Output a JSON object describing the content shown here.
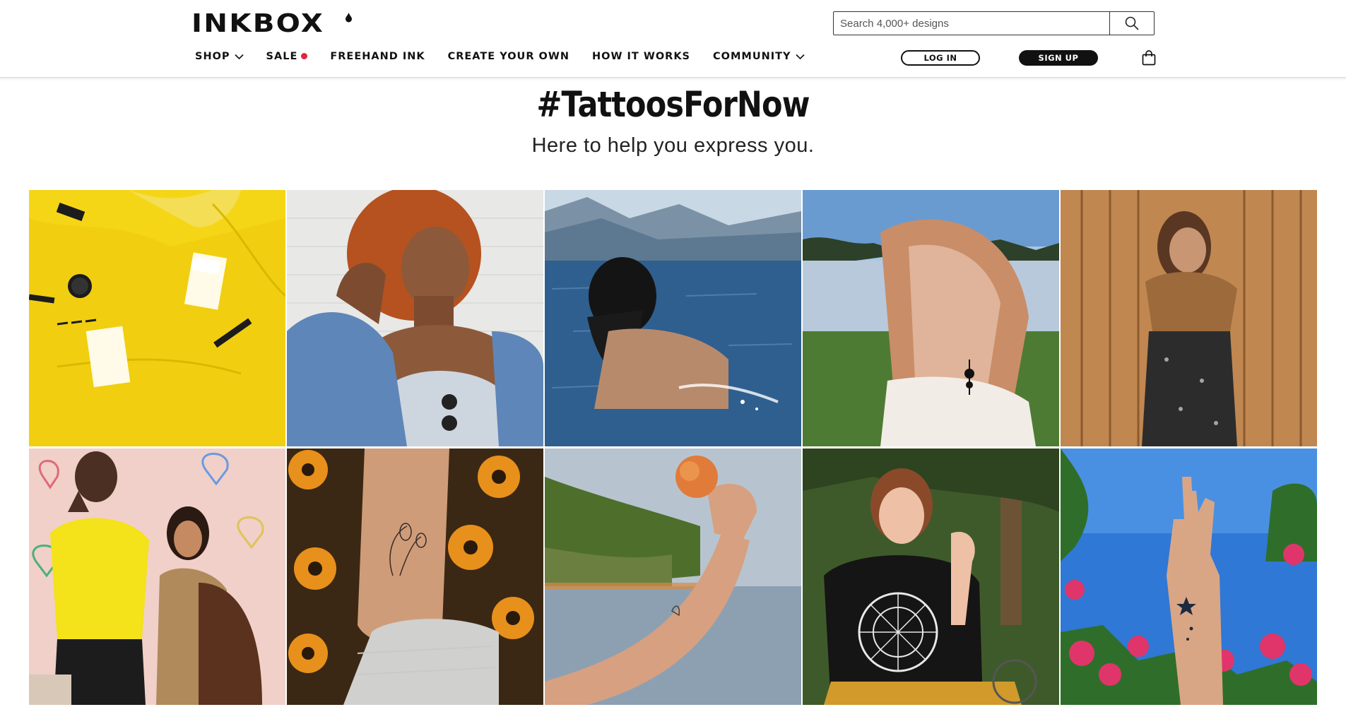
{
  "brand": {
    "logo_text": "INKBOX"
  },
  "search": {
    "placeholder": "Search 4,000+ designs",
    "icon": "search-icon"
  },
  "nav": {
    "items": [
      {
        "label": "SHOP",
        "dropdown": true
      },
      {
        "label": "SALE",
        "badge_color": "#e0263c"
      },
      {
        "label": "FREEHAND INK"
      },
      {
        "label": "CREATE YOUR OWN"
      },
      {
        "label": "HOW IT WORKS"
      },
      {
        "label": "COMMUNITY",
        "dropdown": true
      }
    ]
  },
  "account": {
    "login_label": "LOG IN",
    "signup_label": "SIGN UP",
    "cart_icon": "shopping-bag-icon"
  },
  "hero": {
    "title": "#TattoosForNow",
    "subtitle": "Here to help you express you."
  },
  "gallery": {
    "tiles": [
      {
        "subject": "yellow-freehand-ink-products"
      },
      {
        "subject": "woman-curly-hair-denim-jacket"
      },
      {
        "subject": "woman-swimming-mountain-lake"
      },
      {
        "subject": "woman-back-tattoo-lake"
      },
      {
        "subject": "woman-wooden-fence"
      },
      {
        "subject": "couple-heart-mural"
      },
      {
        "subject": "ankle-flower-tattoo-sunflowers"
      },
      {
        "subject": "arm-holding-peach-lake"
      },
      {
        "subject": "woman-wheelchair-zodiac-shirt"
      },
      {
        "subject": "wrist-star-tattoos-pink-flowers"
      }
    ]
  },
  "colors": {
    "accent_red": "#e0263c",
    "text": "#111111",
    "tile_yellow": "#f4d312",
    "sky_blue": "#2f78d6"
  }
}
